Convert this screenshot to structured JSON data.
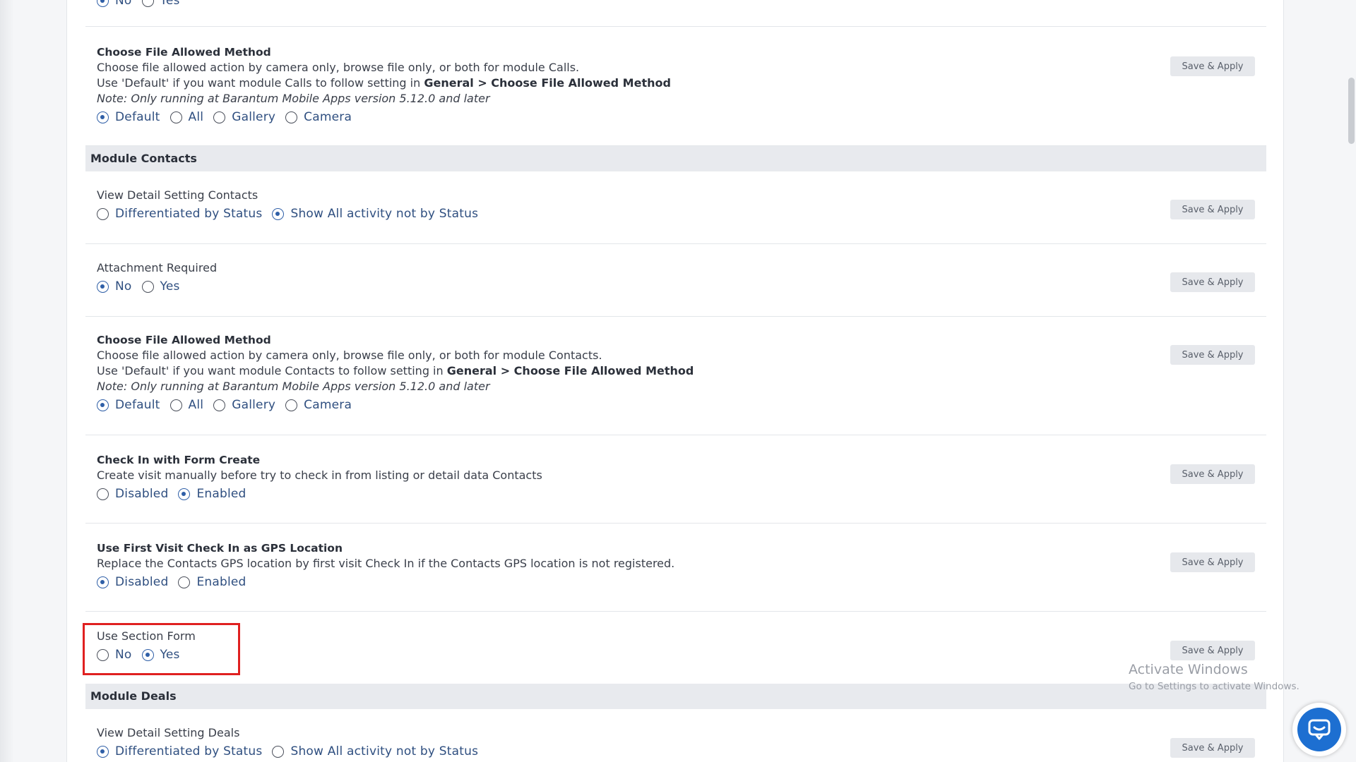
{
  "top_partial": {
    "options": [
      "No",
      "Yes"
    ],
    "selected": 0
  },
  "sections": {
    "contacts_title": "Module Contacts",
    "deals_title": "Module Deals"
  },
  "save_label": "Save & Apply",
  "calls_choose_file": {
    "title": "Choose File Allowed Method",
    "desc1": "Choose file allowed action by camera only, browse file only, or both for module Calls.",
    "desc2_pre": "Use 'Default' if you want module Calls to follow setting in ",
    "desc2_bold": "General > Choose File Allowed Method",
    "note": "Note: Only running at Barantum Mobile Apps version 5.12.0 and later",
    "options": [
      "Default",
      "All",
      "Gallery",
      "Camera"
    ],
    "selected": 0
  },
  "contacts_view_detail": {
    "title": "View Detail Setting Contacts",
    "options": [
      "Differentiated by Status",
      "Show All activity not by Status"
    ],
    "selected": 1
  },
  "contacts_attachment": {
    "title": "Attachment Required",
    "options": [
      "No",
      "Yes"
    ],
    "selected": 0
  },
  "contacts_choose_file": {
    "title": "Choose File Allowed Method",
    "desc1": "Choose file allowed action by camera only, browse file only, or both for module Contacts.",
    "desc2_pre": "Use 'Default' if you want module Contacts to follow setting in ",
    "desc2_bold": "General > Choose File Allowed Method",
    "note": "Note: Only running at Barantum Mobile Apps version 5.12.0 and later",
    "options": [
      "Default",
      "All",
      "Gallery",
      "Camera"
    ],
    "selected": 0
  },
  "contacts_checkin": {
    "title": "Check In with Form Create",
    "desc": "Create visit manually before try to check in from listing or detail data Contacts",
    "options": [
      "Disabled",
      "Enabled"
    ],
    "selected": 1
  },
  "contacts_gps": {
    "title": "Use First Visit Check In as GPS Location",
    "desc": "Replace the Contacts GPS location by first visit Check In if the Contacts GPS location is not registered.",
    "options": [
      "Disabled",
      "Enabled"
    ],
    "selected": 0
  },
  "contacts_section_form": {
    "title": "Use Section Form",
    "options": [
      "No",
      "Yes"
    ],
    "selected": 1
  },
  "deals_view_detail": {
    "title": "View Detail Setting Deals",
    "options": [
      "Differentiated by Status",
      "Show All activity not by Status"
    ],
    "selected": 0
  },
  "watermark": {
    "line1": "Activate Windows",
    "line2": "Go to Settings to activate Windows."
  },
  "icons": {
    "chat": "chat-support-icon"
  },
  "colors": {
    "accent": "#2f5fa7",
    "highlight": "#e02020",
    "chat": "#1d6fd1"
  }
}
